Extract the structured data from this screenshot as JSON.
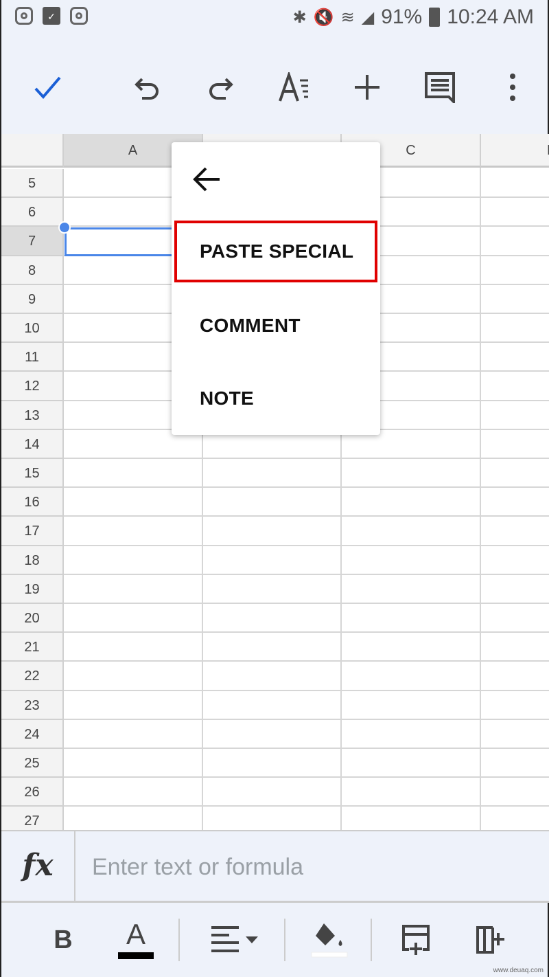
{
  "status_bar": {
    "battery": "91%",
    "time": "10:24 AM"
  },
  "toolbar": {
    "icons": [
      "check-icon",
      "undo-icon",
      "redo-icon",
      "text-format-icon",
      "add-icon",
      "comment-icon",
      "more-vert-icon"
    ]
  },
  "grid": {
    "columns": [
      "A",
      "",
      "C",
      "D"
    ],
    "selected_column": "A",
    "rows": [
      "5",
      "6",
      "7",
      "8",
      "9",
      "10",
      "11",
      "12",
      "13",
      "14",
      "15",
      "16",
      "17",
      "18",
      "19",
      "20",
      "21",
      "22",
      "23",
      "24",
      "25",
      "26",
      "27"
    ],
    "selected_row": "7",
    "selection_color": "#4a86e8"
  },
  "context_menu": {
    "back_icon": "arrow-left-icon",
    "items": [
      {
        "label": "PASTE SPECIAL",
        "highlighted": true
      },
      {
        "label": "COMMENT"
      },
      {
        "label": "NOTE"
      }
    ],
    "highlight_color": "#e00000"
  },
  "formula_bar": {
    "fx_label": "fx",
    "placeholder": "Enter text or formula"
  },
  "bottom_toolbar": {
    "bold_label": "B",
    "text_color_label": "A",
    "icons": [
      "bold-icon",
      "text-color-icon",
      "align-left-icon",
      "fill-color-icon",
      "insert-row-icon",
      "insert-column-icon"
    ]
  },
  "watermark": "www.deuaq.com"
}
